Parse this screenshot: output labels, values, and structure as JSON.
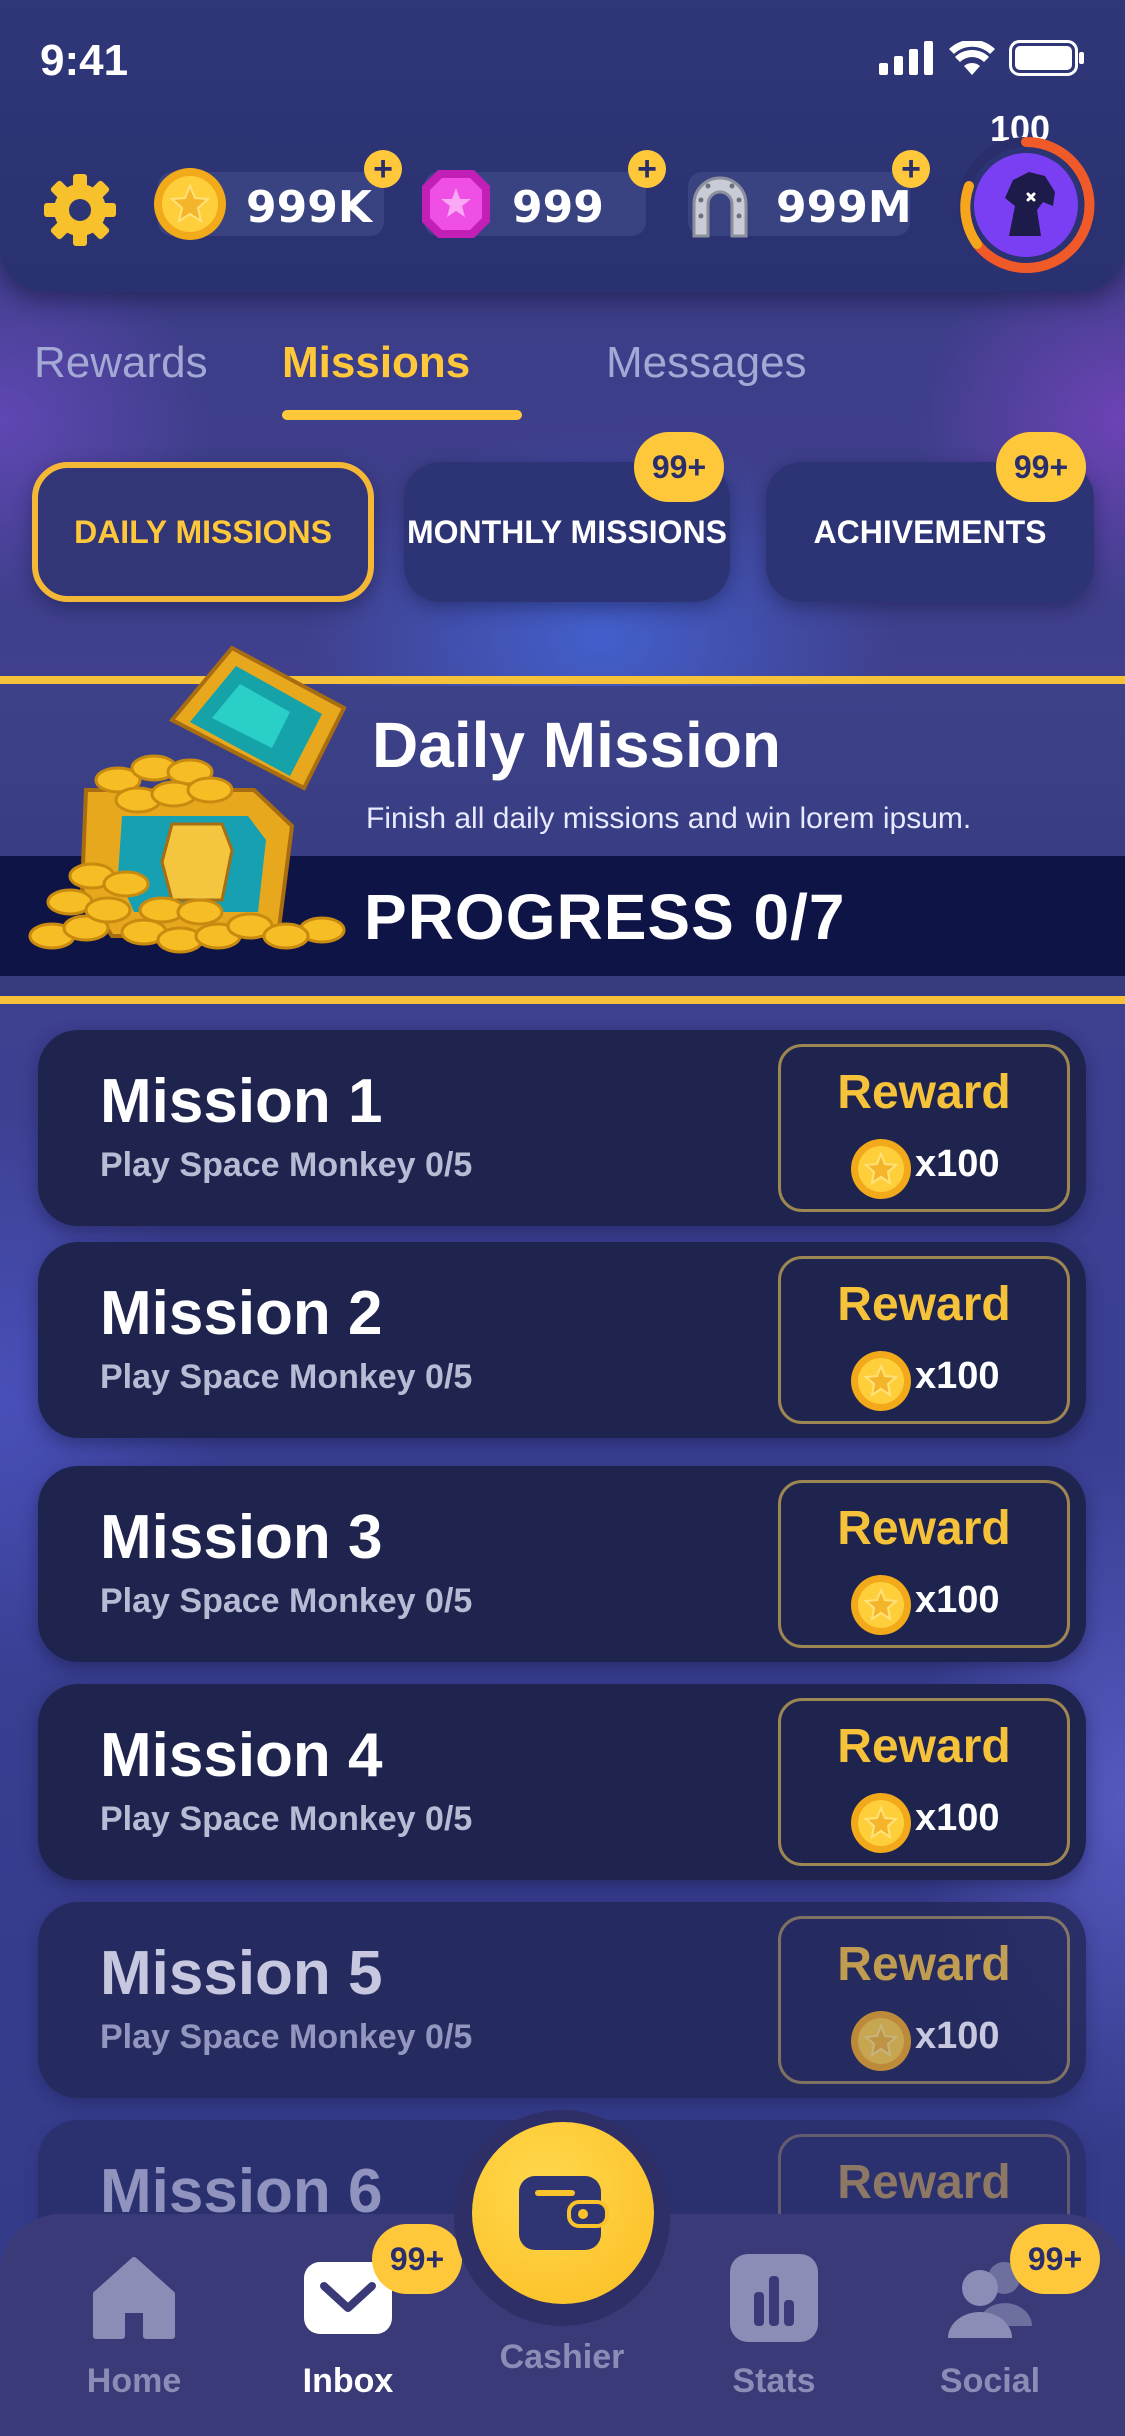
{
  "status_bar": {
    "time": "9:41"
  },
  "currencies": {
    "coins": {
      "value": "999K",
      "icon": "coin-icon"
    },
    "gems": {
      "value": "999",
      "icon": "gem-icon"
    },
    "horseshoes": {
      "value": "999M",
      "icon": "horseshoe-icon"
    },
    "plus_label": "+"
  },
  "profile": {
    "level": "100",
    "avatar_icon": "horse-head-icon"
  },
  "tabs": [
    {
      "label": "Rewards",
      "active": false
    },
    {
      "label": "Missions",
      "active": true
    },
    {
      "label": "Messages",
      "active": false
    }
  ],
  "segments": [
    {
      "label": "DAILY MISSIONS",
      "active": true,
      "badge": ""
    },
    {
      "label": "MONTHLY MISSIONS",
      "active": false,
      "badge": "99+"
    },
    {
      "label": "ACHIVEMENTS",
      "active": false,
      "badge": "99+"
    }
  ],
  "banner": {
    "title": "Daily Mission",
    "subtitle": "Finish all daily missions and win lorem ipsum.",
    "progress": "PROGRESS 0/7",
    "icon": "treasure-chest-icon"
  },
  "missions": [
    {
      "title": "Mission 1",
      "subtitle": "Play Space Monkey 0/5",
      "reward_label": "Reward",
      "reward_amount": "x100"
    },
    {
      "title": "Mission 2",
      "subtitle": "Play Space Monkey 0/5",
      "reward_label": "Reward",
      "reward_amount": "x100"
    },
    {
      "title": "Mission 3",
      "subtitle": "Play Space Monkey 0/5",
      "reward_label": "Reward",
      "reward_amount": "x100"
    },
    {
      "title": "Mission 4",
      "subtitle": "Play Space Monkey 0/5",
      "reward_label": "Reward",
      "reward_amount": "x100"
    },
    {
      "title": "Mission 5",
      "subtitle": "Play Space Monkey 0/5",
      "reward_label": "Reward",
      "reward_amount": "x100"
    },
    {
      "title": "Mission 6",
      "subtitle": "",
      "reward_label": "Reward",
      "reward_amount": ""
    }
  ],
  "nav": {
    "home": {
      "label": "Home",
      "icon": "home-icon"
    },
    "inbox": {
      "label": "Inbox",
      "icon": "mail-icon",
      "badge": "99+"
    },
    "cashier": {
      "label": "Cashier",
      "icon": "wallet-icon"
    },
    "stats": {
      "label": "Stats",
      "icon": "bar-chart-icon"
    },
    "social": {
      "label": "Social",
      "icon": "users-icon",
      "badge": "99+"
    }
  },
  "colors": {
    "accent": "#ffc83a",
    "background": "#3a3c84",
    "card": "#1f244f",
    "reward_border": "#9c8651"
  }
}
